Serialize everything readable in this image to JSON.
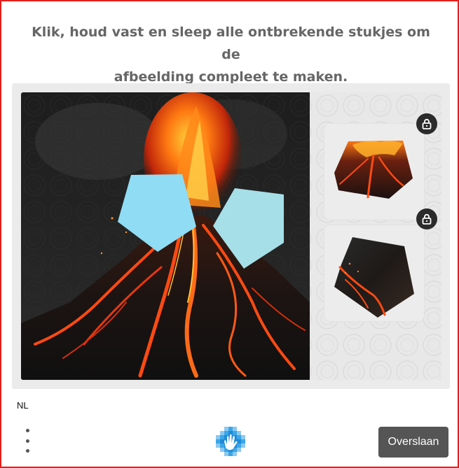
{
  "prompt": {
    "line1": "Klik, houd vast en sleep alle ontbrekende stukjes om de",
    "line2": "afbeelding compleet te maken."
  },
  "puzzle": {
    "image_subject": "erupting volcano with lava flows",
    "missing_slot_colors": [
      "#8fdcf4",
      "#a6dfe8"
    ],
    "pieces": [
      {
        "name": "volcano-summit-piece",
        "locked_icon": "lock-icon"
      },
      {
        "name": "lava-slope-piece",
        "locked_icon": "lock-icon"
      }
    ]
  },
  "footer": {
    "language": "NL",
    "menu_icon": "vertical-dots-icon",
    "logo_icon": "hand-logo-icon",
    "skip_label": "Overslaan"
  },
  "colors": {
    "border": "#e0201c",
    "button": "#555555",
    "lock_badge": "#2b2b2b"
  }
}
